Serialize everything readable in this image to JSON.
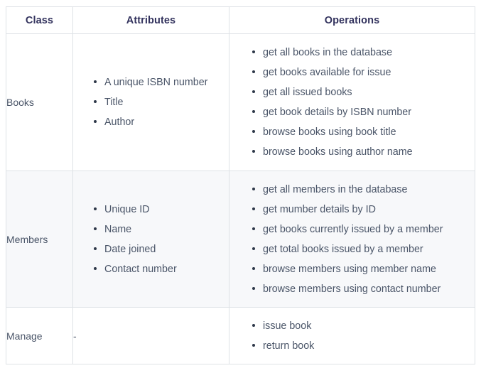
{
  "table": {
    "columns": [
      {
        "key": "class",
        "label": "Class"
      },
      {
        "key": "attributes",
        "label": "Attributes"
      },
      {
        "key": "operations",
        "label": "Operations"
      }
    ],
    "rows": [
      {
        "class": "Books",
        "attributes_type": "list",
        "attributes": [
          "A unique ISBN number",
          "Title",
          "Author"
        ],
        "operations": [
          "get all books in the database",
          "get books available for issue",
          "get all issued books",
          "get book details by ISBN number",
          "browse books using book title",
          "browse books using author name"
        ],
        "shaded": false
      },
      {
        "class": "Members",
        "attributes_type": "list",
        "attributes": [
          "Unique ID",
          "Name",
          "Date joined",
          "Contact number"
        ],
        "operations": [
          "get all members in the database",
          "get mumber details by ID",
          "get books currently issued by a member",
          "get total books issued by a member",
          "browse members using member name",
          "browse members using contact number"
        ],
        "shaded": true
      },
      {
        "class": "Manage",
        "attributes_type": "text",
        "attributes_text": "-",
        "operations": [
          "issue book",
          "return book"
        ],
        "shaded": false
      }
    ]
  },
  "colors": {
    "border": "#dee2e6",
    "header_text": "#32325d",
    "body_text": "#4a5568",
    "bullet": "#2d3748",
    "row_shaded_bg": "#f7f8fa",
    "row_plain_bg": "#ffffff",
    "page_bg": "#ffffff"
  }
}
